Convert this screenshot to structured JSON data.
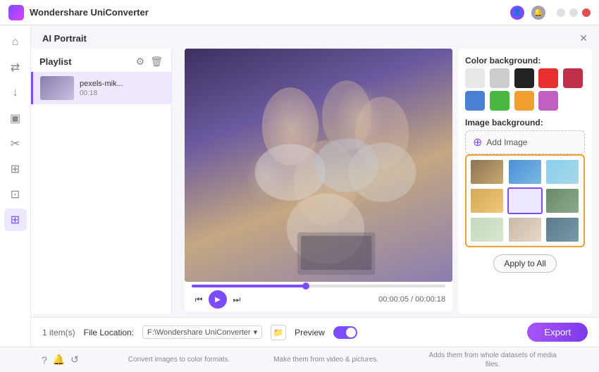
{
  "titleBar": {
    "appName": "Wondershare UniConverter",
    "windowControls": [
      "minimize",
      "maximize",
      "close"
    ]
  },
  "sidebar": {
    "items": [
      {
        "id": "home",
        "icon": "⌂",
        "active": false
      },
      {
        "id": "convert",
        "icon": "⇄",
        "active": false
      },
      {
        "id": "download",
        "icon": "↓",
        "active": false
      },
      {
        "id": "screen",
        "icon": "▣",
        "active": false
      },
      {
        "id": "cut",
        "icon": "✂",
        "active": false
      },
      {
        "id": "merge",
        "icon": "⊞",
        "active": false
      },
      {
        "id": "compress",
        "icon": "⊡",
        "active": false
      },
      {
        "id": "tools",
        "icon": "⊞",
        "active": true
      }
    ]
  },
  "dialog": {
    "title": "AI Portrait",
    "closeBtn": "✕"
  },
  "playlist": {
    "title": "Playlist",
    "items": [
      {
        "filename": "pexels-mik...",
        "duration": "00:18"
      }
    ]
  },
  "playback": {
    "progressPercent": 45,
    "currentTime": "00:00:05",
    "totalTime": "00:00:18",
    "controls": {
      "prev": "⏮",
      "play": "▶",
      "next": "⏭"
    }
  },
  "bottomBar": {
    "itemsCount": "1 item(s)",
    "fileLocationLabel": "File Location:",
    "fileLocationPath": "F:\\Wondershare UniConverter",
    "previewLabel": "Preview",
    "exportLabel": "Export"
  },
  "rightPanel": {
    "colorBackground": {
      "label": "Color background:",
      "swatches": [
        {
          "color": "#e8e8e8",
          "id": "white"
        },
        {
          "color": "#cccccc",
          "id": "lightgray"
        },
        {
          "color": "#222222",
          "id": "black"
        },
        {
          "color": "#e83030",
          "id": "red"
        },
        {
          "color": "#c0304a",
          "id": "darkred"
        },
        {
          "color": "#d94040",
          "id": "crimson"
        },
        {
          "color": "#4a80d4",
          "id": "blue"
        },
        {
          "color": "#4ab840",
          "id": "green"
        },
        {
          "color": "#f0a030",
          "id": "orange"
        },
        {
          "color": "#c060c0",
          "id": "purple"
        }
      ]
    },
    "imageBackground": {
      "label": "Image background:",
      "addImageLabel": "Add Image",
      "images": [
        {
          "id": "img1",
          "class": "bg1"
        },
        {
          "id": "img2",
          "class": "bg2"
        },
        {
          "id": "img3",
          "class": "bg3"
        },
        {
          "id": "img4",
          "class": "bg4"
        },
        {
          "id": "img5",
          "class": "bg5"
        },
        {
          "id": "img6",
          "class": "bg6",
          "selected": true
        },
        {
          "id": "img7",
          "class": "bg7"
        },
        {
          "id": "img8",
          "class": "bg8"
        },
        {
          "id": "img9",
          "class": "bg9"
        }
      ]
    },
    "applyToAllLabel": "Apply to All"
  },
  "footer": {
    "items": [
      "Convert images to color formats.",
      "Make them from video & pictures.",
      "Adds them from whole datasets of media files."
    ]
  }
}
